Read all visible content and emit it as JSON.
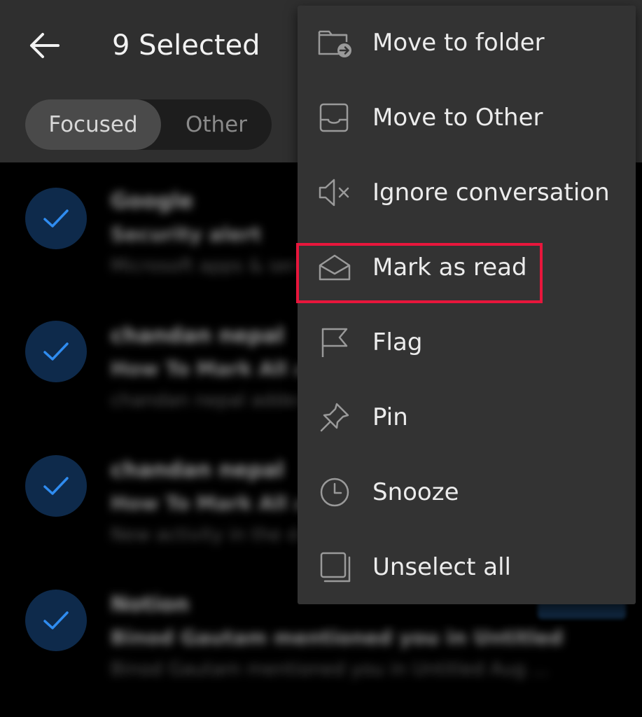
{
  "header": {
    "title": "9 Selected",
    "back_icon": "arrow-left-icon",
    "tabs": {
      "focused": "Focused",
      "other": "Other",
      "active": "Focused"
    }
  },
  "messages": [
    {
      "sender": "Google",
      "subject": "Security alert",
      "preview": "Microsoft apps & services",
      "selected": true
    },
    {
      "sender": "chandan nepal",
      "subject": "How To Mark All as Read",
      "preview": "chandan nepal added a comment",
      "selected": true
    },
    {
      "sender": "chandan nepal",
      "subject": "How To Mark All as Read",
      "preview": "New activity in the document",
      "selected": true
    },
    {
      "sender": "Notion",
      "subject": "Binod Gautam mentioned you in Untitled",
      "preview": "Binod Gautam mentioned you in Untitled Aug ...",
      "selected": true
    }
  ],
  "menu": {
    "items": [
      {
        "label": "Move to folder",
        "icon": "folder-move-icon"
      },
      {
        "label": "Move to Other",
        "icon": "inbox-tray-icon"
      },
      {
        "label": "Ignore conversation",
        "icon": "mute-speaker-icon"
      },
      {
        "label": "Mark as read",
        "icon": "open-envelope-icon",
        "highlighted": true
      },
      {
        "label": "Flag",
        "icon": "flag-icon"
      },
      {
        "label": "Pin",
        "icon": "pin-icon"
      },
      {
        "label": "Snooze",
        "icon": "clock-icon"
      },
      {
        "label": "Unselect all",
        "icon": "stacked-squares-icon"
      }
    ]
  },
  "colors": {
    "header_bg": "#2f2f2f",
    "menu_bg": "#333333",
    "check_bg": "#0e2a4b",
    "check_mark": "#2f8cf0",
    "highlight_border": "#e8163c"
  }
}
